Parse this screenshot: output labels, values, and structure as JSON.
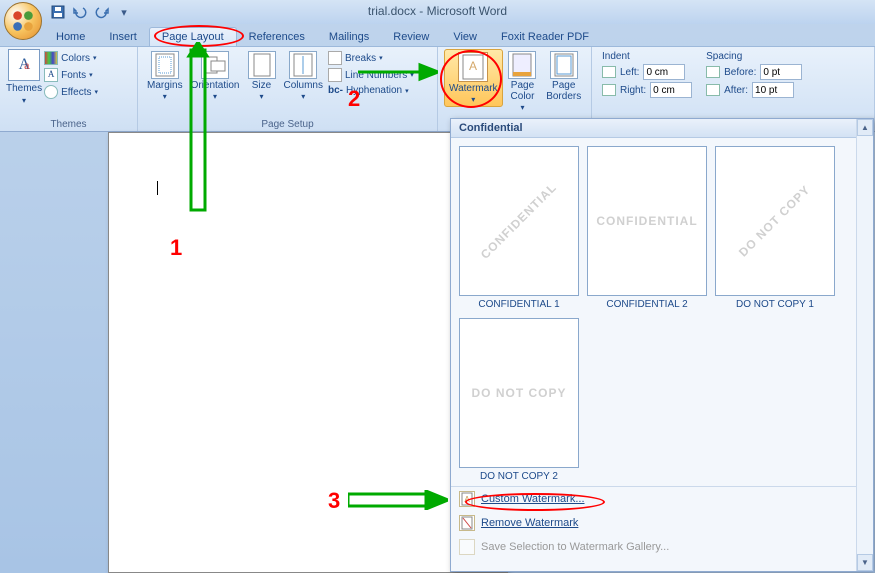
{
  "titlebar": {
    "title": "trial.docx - Microsoft Word"
  },
  "tabs": {
    "home": "Home",
    "insert": "Insert",
    "page_layout": "Page Layout",
    "references": "References",
    "mailings": "Mailings",
    "review": "Review",
    "view": "View",
    "foxit": "Foxit Reader PDF"
  },
  "ribbon": {
    "themes": {
      "label": "Themes",
      "themes_btn": "Themes",
      "colors": "Colors",
      "fonts": "Fonts",
      "effects": "Effects"
    },
    "page_setup": {
      "label": "Page Setup",
      "margins": "Margins",
      "orientation": "Orientation",
      "size": "Size",
      "columns": "Columns",
      "breaks": "Breaks",
      "line_numbers": "Line Numbers",
      "hyphenation": "Hyphenation"
    },
    "page_bg": {
      "watermark": "Watermark",
      "page_color": "Page Color",
      "page_borders": "Page Borders"
    },
    "paragraph": {
      "indent_label": "Indent",
      "spacing_label": "Spacing",
      "left_label": "Left:",
      "right_label": "Right:",
      "before_label": "Before:",
      "after_label": "After:",
      "left_val": "0 cm",
      "right_val": "0 cm",
      "before_val": "0 pt",
      "after_val": "10 pt"
    }
  },
  "wm_panel": {
    "header": "Confidential",
    "items": [
      {
        "text": "CONFIDENTIAL",
        "caption": "CONFIDENTIAL 1",
        "diag": true
      },
      {
        "text": "CONFIDENTIAL",
        "caption": "CONFIDENTIAL 2",
        "diag": false
      },
      {
        "text": "DO NOT COPY",
        "caption": "DO NOT COPY 1",
        "diag": true
      },
      {
        "text": "DO NOT COPY",
        "caption": "DO NOT COPY 2",
        "diag": false
      }
    ],
    "custom": "Custom Watermark...",
    "remove": "Remove Watermark",
    "save_gallery": "Save Selection to Watermark Gallery..."
  },
  "annotations": {
    "n1": "1",
    "n2": "2",
    "n3": "3"
  }
}
